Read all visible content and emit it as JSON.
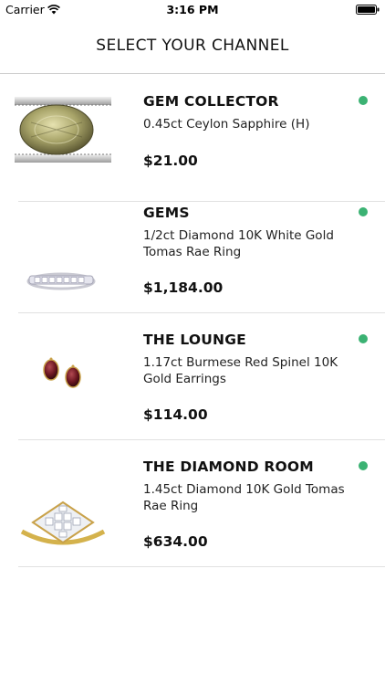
{
  "status_bar": {
    "carrier": "Carrier",
    "time": "3:16 PM"
  },
  "nav": {
    "title": "SELECT YOUR CHANNEL"
  },
  "colors": {
    "live_dot": "#3bb273",
    "divider": "#e1e1e1"
  },
  "channels": [
    {
      "name": "GEM COLLECTOR",
      "product": "0.45ct Ceylon Sapphire (H)",
      "price": "$21.00",
      "image_icon": "sapphire-in-tweezers-icon"
    },
    {
      "name": "GEMS",
      "product": "1/2ct Diamond 10K White Gold Tomas Rae Ring",
      "price": "$1,184.00",
      "image_icon": "diamond-band-ring-icon"
    },
    {
      "name": "THE LOUNGE",
      "product": "1.17ct Burmese Red Spinel 10K Gold Earrings",
      "price": "$114.00",
      "image_icon": "red-spinel-earrings-icon"
    },
    {
      "name": "THE DIAMOND ROOM",
      "product": "1.45ct Diamond 10K Gold Tomas Rae Ring",
      "price": "$634.00",
      "image_icon": "diamond-cluster-ring-icon"
    }
  ]
}
